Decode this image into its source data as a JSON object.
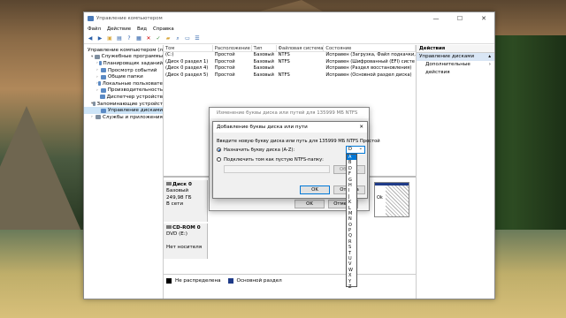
{
  "window": {
    "title": "Управление компьютером",
    "minimize": "—",
    "maximize": "☐",
    "close": "✕"
  },
  "menu": [
    "Файл",
    "Действие",
    "Вид",
    "Справка"
  ],
  "tree": [
    {
      "label": "Управление компьютером (л",
      "indent": 0,
      "arrow": ""
    },
    {
      "label": "Служебные программы",
      "indent": 1,
      "arrow": "▾"
    },
    {
      "label": "Планировщик заданий",
      "indent": 2,
      "arrow": "›"
    },
    {
      "label": "Просмотр событий",
      "indent": 2,
      "arrow": "›"
    },
    {
      "label": "Общие папки",
      "indent": 2,
      "arrow": "›"
    },
    {
      "label": "Локальные пользовате",
      "indent": 2,
      "arrow": "›"
    },
    {
      "label": "Производительность",
      "indent": 2,
      "arrow": "›"
    },
    {
      "label": "Диспетчер устройств",
      "indent": 2,
      "arrow": ""
    },
    {
      "label": "Запоминающие устройст",
      "indent": 1,
      "arrow": "▾"
    },
    {
      "label": "Управление дисками",
      "indent": 2,
      "arrow": "",
      "selected": true
    },
    {
      "label": "Службы и приложения",
      "indent": 1,
      "arrow": "›"
    }
  ],
  "table": {
    "headers": [
      "Том",
      "Расположение",
      "Тип",
      "Файловая система",
      "Состояние"
    ],
    "rows": [
      [
        "(C:)",
        "Простой",
        "Базовый",
        "NTFS",
        "Исправен (Загрузка, Файл подкачки,"
      ],
      [
        "(Диск 0 раздел 1)",
        "Простой",
        "Базовый",
        "NTFS",
        "Исправен (Шифрованный (EFI) систе"
      ],
      [
        "(Диск 0 раздел 4)",
        "Простой",
        "Базовый",
        "",
        "Исправен (Раздел восстановления)"
      ],
      [
        "(Диск 0 раздел 5)",
        "Простой",
        "Базовый",
        "NTFS",
        "Исправен (Основной раздел диска)"
      ]
    ]
  },
  "disks": [
    {
      "name": "Диск 0",
      "line2": "Базовый",
      "line3": "249,98 ГБ",
      "line4": "В сети",
      "partition_text": "Ok"
    },
    {
      "name": "CD-ROM 0",
      "line2": "DVD (E:)",
      "line3": "",
      "line4": "Нет носителя"
    }
  ],
  "partition_label": "Ok",
  "legend": [
    {
      "label": "Не распределена",
      "color": "#000000"
    },
    {
      "label": "Основной раздел",
      "color": "#1f3b88"
    }
  ],
  "actions": {
    "header": "Действия",
    "section": "Управление дисками",
    "item": "Дополнительные действия",
    "section_arrow": "▴",
    "item_arrow": "›"
  },
  "dialog_outer": {
    "title": "Изменение буквы диска или путей для 135999 МБ NTFS Прост",
    "ok": "OK",
    "cancel": "Отмена"
  },
  "dialog_inner": {
    "title": "Добавление буквы диска или пути",
    "close": "✕",
    "prompt": "Введите новую букву диска или путь для 135999 МБ NTFS Простой",
    "option1": "Назначить букву диска (A-Z):",
    "option2": "Подключить том как пустую NTFS-папку:",
    "browse": "Обзор...",
    "ok": "OK",
    "cancel": "Отмена"
  },
  "dropdown": {
    "selected": "D",
    "arrow": "⌄",
    "options": [
      "A",
      "B",
      "D",
      "F",
      "G",
      "H",
      "I",
      "J",
      "K",
      "L",
      "M",
      "N",
      "O",
      "P",
      "Q",
      "R",
      "S",
      "T",
      "U",
      "V",
      "W",
      "X",
      "Y",
      "Z"
    ],
    "highlighted": "A"
  },
  "icons": {
    "back": "back-arrow-icon",
    "forward": "forward-arrow-icon",
    "up": "up-folder-icon",
    "properties": "properties-icon",
    "help": "help-icon",
    "delete": "delete-icon"
  }
}
